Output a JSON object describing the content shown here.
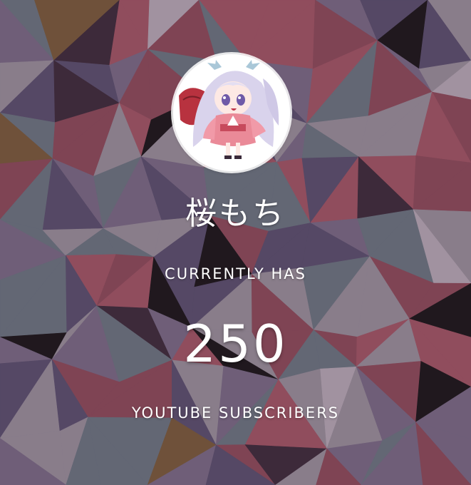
{
  "channel": {
    "name": "桜もち",
    "avatar_icon": "anime-girl-avatar-icon"
  },
  "stats": {
    "label_top": "CURRENTLY HAS",
    "count": "250",
    "label_bottom": "YOUTUBE SUBSCRIBERS"
  },
  "background": {
    "style": "low-poly triangle mosaic",
    "palette": [
      "#5b4f6e",
      "#7a6a86",
      "#8e4a5a",
      "#a35565",
      "#6c7480",
      "#9a8f9c",
      "#3e2a3a",
      "#b7a9b6",
      "#1a1418",
      "#7a5a3a"
    ]
  }
}
